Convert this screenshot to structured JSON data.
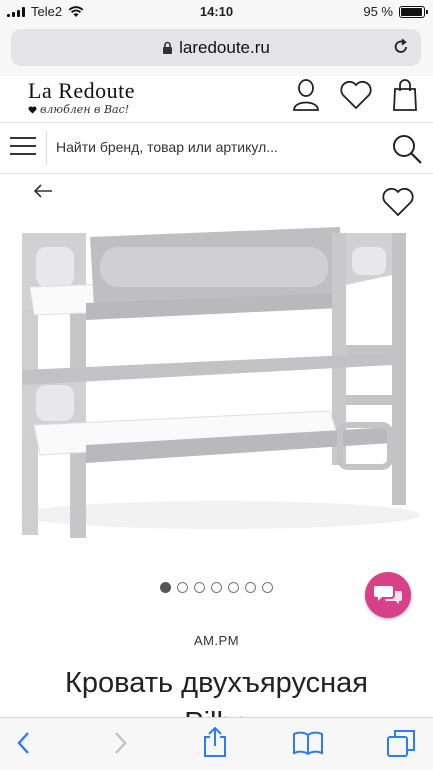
{
  "status_bar": {
    "carrier": "Tele2",
    "time": "14:10",
    "battery_percent": "95 %",
    "battery_level": 0.95
  },
  "browser": {
    "url": "laredoute.ru",
    "icons": [
      "lock-icon",
      "reload-icon"
    ]
  },
  "site_header": {
    "logo": "La Redoute",
    "tagline": "влюблен в Вас!",
    "icons": [
      "account-icon",
      "wishlist-heart-icon",
      "shopping-bag-icon"
    ]
  },
  "search": {
    "placeholder": "Найти бренд, товар или артикул..."
  },
  "product": {
    "image_count": 7,
    "active_image": 1,
    "brand": "AM.PM",
    "title_line1": "Кровать двухъярусная",
    "title_line2": "Pilha"
  },
  "toolbar": {
    "icons": [
      "back-icon",
      "forward-icon",
      "share-icon",
      "bookmarks-icon",
      "tabs-icon"
    ]
  },
  "colors": {
    "chat_button": "#d8408a",
    "bed_frame": "#c9c9cb",
    "accent_blue": "#2f7bf5"
  }
}
